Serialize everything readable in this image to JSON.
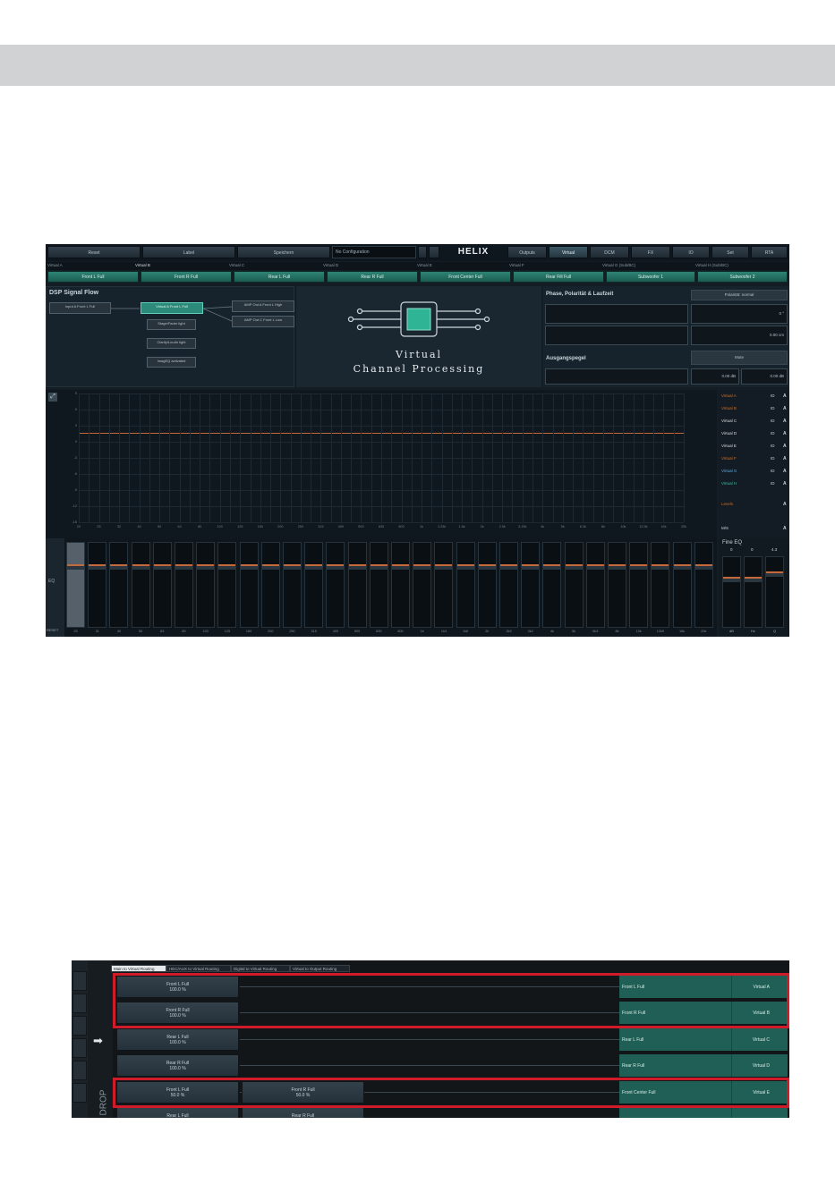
{
  "toolbar": {
    "buttons": [
      "Reset",
      "Label",
      "Speichern",
      "Outputs",
      "Virtual",
      "DCM",
      "FX",
      "IO",
      "Set",
      "RTA"
    ],
    "config": "No Configuration",
    "logo": "HELIX"
  },
  "virtual_checks": [
    "Virtual A",
    "Virtual B",
    "Virtual C",
    "Virtual D",
    "Virtual E",
    "Virtual F",
    "Virtual G (Sub/BC)",
    "Virtual H (Sub/BC)"
  ],
  "channel_buttons": [
    "Front L Full",
    "Front R Full",
    "Rear L Full",
    "Rear R Full",
    "Front Center Full",
    "Rear Fill Full",
    "Subwoofer 1",
    "Subwoofer 2"
  ],
  "flow": {
    "title": "DSP Signal Flow",
    "nodes": [
      "Input A Front L Full",
      "Virtual A Front L Full",
      "Stage/Fader light",
      "Clarity/Loudn light",
      "ImagEQ activated",
      "AMP Out A Front L High",
      "AMP Out C Front L Low"
    ]
  },
  "vcp": {
    "line1": "Virtual",
    "line2": "Channel Processing"
  },
  "phase": {
    "title": "Phase, Polarität & Laufzeit",
    "polarity_btn": "Polarität: normal",
    "phase_val": "0 °",
    "delay_val": "0.00 cm",
    "level_title": "Ausgangspegel",
    "mute_btn": "Mute",
    "level_db1": "0.00 dB",
    "level_db2": "0.00 dB"
  },
  "graph": {
    "y_ticks": [
      "9",
      "6",
      "3",
      "0",
      "-3",
      "-6",
      "-9",
      "-12",
      "-15"
    ],
    "x_ticks": [
      "20",
      "22",
      "25",
      "28",
      "32",
      "36",
      "40",
      "45",
      "50",
      "56",
      "63",
      "71",
      "80",
      "90",
      "100",
      "112",
      "125",
      "140",
      "160",
      "180",
      "200",
      "225",
      "250",
      "280",
      "315",
      "355",
      "400",
      "450",
      "500",
      "560",
      "630",
      "710",
      "800",
      "900",
      "1k",
      "1.1k",
      "1.25k",
      "1.4k",
      "1.6k",
      "1.8k",
      "2k",
      "2.25k",
      "2.5k",
      "2.8k",
      "3.15k",
      "3.55k",
      "4k",
      "4.5k",
      "5k",
      "5.6k",
      "6.3k",
      "7.1k",
      "8k",
      "9k",
      "10k",
      "11k",
      "12.5k",
      "14k",
      "16k",
      "18k",
      "20k"
    ]
  },
  "virtual_list": {
    "items": [
      {
        "name": "Virtual A",
        "color": "#c8702e"
      },
      {
        "name": "Virtual B",
        "color": "#c8702e"
      },
      {
        "name": "Virtual C",
        "color": "#d8dde0"
      },
      {
        "name": "Virtual D",
        "color": "#d8dde0"
      },
      {
        "name": "Virtual E",
        "color": "#d8dde0"
      },
      {
        "name": "Virtual F",
        "color": "#c8702e"
      },
      {
        "name": "Virtual G",
        "color": "#5fa8d8"
      },
      {
        "name": "Virtual H",
        "color": "#3fb8a0"
      }
    ],
    "num": "ID",
    "icon": "A",
    "label_levels": "Levels",
    "label_ms": "M/S"
  },
  "faders": {
    "side_label": "EQ",
    "reset": "RESET",
    "freqs": [
      "25",
      "31",
      "40",
      "50",
      "63",
      "80",
      "100",
      "125",
      "160",
      "200",
      "250",
      "315",
      "400",
      "500",
      "630",
      "800",
      "1k",
      "1k3",
      "1k6",
      "2k",
      "2k5",
      "3k2",
      "4k",
      "5k",
      "6k3",
      "8k",
      "10k",
      "12k5",
      "16k",
      "20k"
    ]
  },
  "fine_eq": {
    "title": "Fine EQ",
    "vals": [
      "0",
      "0",
      "4.3"
    ],
    "labels": [
      "dB",
      "Hz",
      "Q"
    ]
  },
  "routing": {
    "tabs": [
      "Main to Virtual Routing",
      "HEC/AUX to Virtual Routing",
      "Digital to Virtual Routing",
      "Virtual to Output Routing"
    ],
    "drop_label": "DROP",
    "rows": [
      {
        "sources": [
          {
            "name": "Front L Full",
            "pct": "100.0 %"
          }
        ],
        "dest": "Front L Full",
        "virtual": "Virtual A"
      },
      {
        "sources": [
          {
            "name": "Front R Full",
            "pct": "100.0 %"
          }
        ],
        "dest": "Front R Full",
        "virtual": "Virtual B"
      },
      {
        "sources": [
          {
            "name": "Rear L Full",
            "pct": "100.0 %"
          }
        ],
        "dest": "Rear L Full",
        "virtual": "Virtual C"
      },
      {
        "sources": [
          {
            "name": "Rear R Full",
            "pct": "100.0 %"
          }
        ],
        "dest": "Rear R Full",
        "virtual": "Virtual D"
      },
      {
        "sources": [
          {
            "name": "Front L Full",
            "pct": "50.0 %"
          },
          {
            "name": "Front R Full",
            "pct": "50.0 %"
          }
        ],
        "dest": "Front Center Full",
        "virtual": "Virtual E"
      },
      {
        "sources": [
          {
            "name": "Rear L Full",
            "pct": ""
          },
          {
            "name": "Rear R Full",
            "pct": ""
          }
        ],
        "dest": "",
        "virtual": ""
      }
    ]
  }
}
